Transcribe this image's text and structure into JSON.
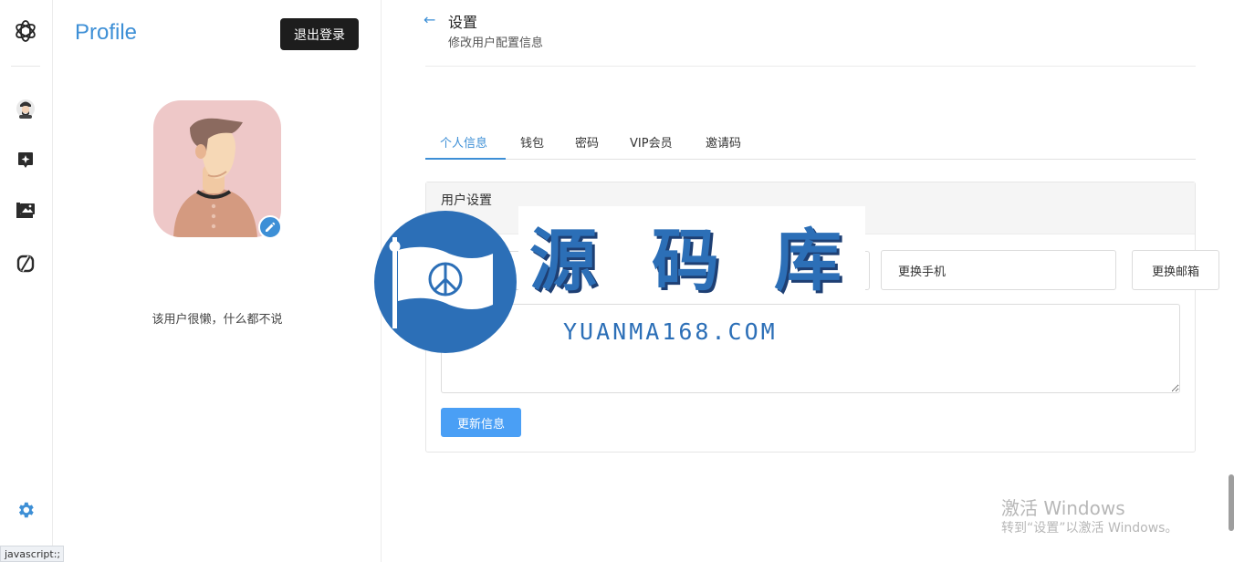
{
  "profile": {
    "title": "Profile",
    "logout_label": "退出登录",
    "bio": "该用户很懒，什么都不说"
  },
  "header": {
    "title": "设置",
    "subtitle": "修改用户配置信息"
  },
  "tabs": [
    {
      "label": "个人信息",
      "active": true
    },
    {
      "label": "钱包"
    },
    {
      "label": "密码"
    },
    {
      "label": "VIP会员"
    },
    {
      "label": "邀请码"
    }
  ],
  "user_settings": {
    "card_title": "用户设置",
    "change_phone_label": "更换手机",
    "change_email_label": "更换邮箱",
    "submit_label": "更新信息"
  },
  "watermark": {
    "brand": "源码库",
    "url": "YUANMA168.COM"
  },
  "windows_notice": {
    "line1": "激活 Windows",
    "line2": "转到“设置”以激活 Windows。"
  },
  "status_bar": {
    "text": "javascript:;"
  },
  "icons": {
    "logo": "openai-logo-icon",
    "nav": [
      "user-avatar-icon",
      "sparkle-chat-icon",
      "image-gallery-icon",
      "no-sync-icon"
    ],
    "settings": "gear-icon",
    "edit": "pencil-icon",
    "back": "arrow-left-icon"
  },
  "colors": {
    "accent": "#3d8fd6",
    "primary_button": "#4a9ff5",
    "dark_button": "#1d1d1d"
  }
}
